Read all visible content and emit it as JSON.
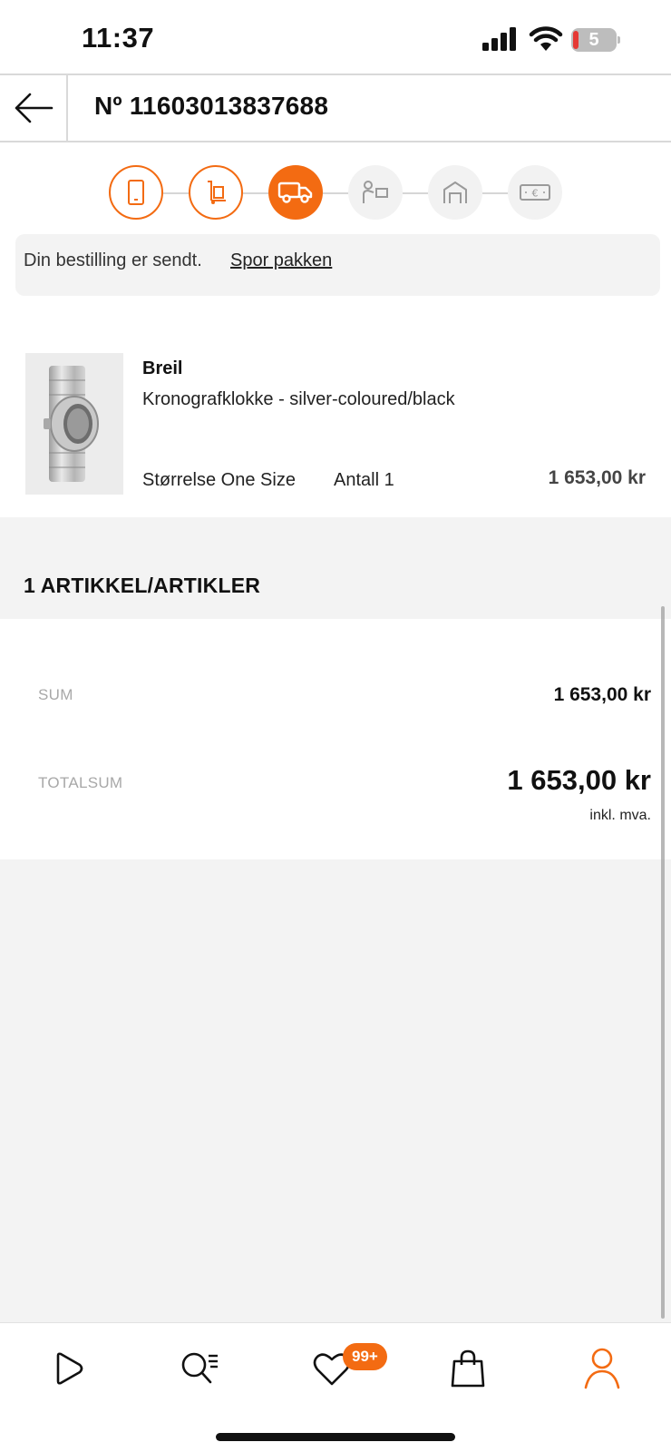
{
  "status_bar": {
    "time": "11:37",
    "battery_level": "5"
  },
  "header": {
    "order_number": "Nº 11603013837688",
    "back_icon": "arrow-left-icon"
  },
  "tracker": {
    "steps": [
      {
        "icon": "phone-icon",
        "state": "done"
      },
      {
        "icon": "hand-truck-icon",
        "state": "done"
      },
      {
        "icon": "delivery-truck-icon",
        "state": "active"
      },
      {
        "icon": "person-package-icon",
        "state": "todo"
      },
      {
        "icon": "pickup-store-icon",
        "state": "todo"
      },
      {
        "icon": "euro-bill-icon",
        "state": "todo"
      }
    ]
  },
  "notice": {
    "text": "Din bestilling er sendt.",
    "link": "Spor pakken"
  },
  "product": {
    "brand": "Breil",
    "name": "Kronografklokke - silver-coloured/black",
    "size": "Størrelse One Size",
    "quantity": "Antall 1",
    "price": "1 653,00 kr",
    "image_icon": "watch-product-image"
  },
  "summary": {
    "count_title": "1 ARTIKKEL/ARTIKLER",
    "sum_label": "SUM",
    "sum_value": "1 653,00 kr",
    "total_label": "TOTALSUM",
    "total_value": "1 653,00 kr",
    "vat_note": "inkl. mva."
  },
  "bottom_nav": {
    "items": [
      {
        "name": "play-icon"
      },
      {
        "name": "search-filter-icon"
      },
      {
        "name": "heart-icon",
        "badge": "99+"
      },
      {
        "name": "shopping-bag-icon"
      },
      {
        "name": "user-icon",
        "active": true
      }
    ]
  },
  "colors": {
    "accent": "#f36b12",
    "inactive_step": "#f2f2f2",
    "background_gray": "#f3f3f3"
  }
}
